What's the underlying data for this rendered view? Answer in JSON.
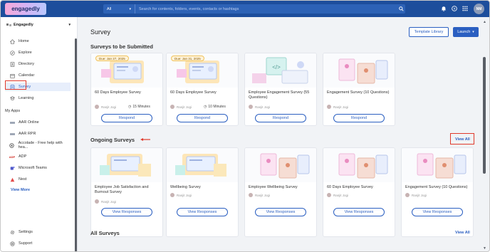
{
  "topbar": {
    "logo": "engagedly",
    "search_scope": "All",
    "search_placeholder": "Search for contents, folders, events, contacts or hashtags",
    "user_initials": "NM"
  },
  "sidebar": {
    "org_name": "Engagedly",
    "items": [
      {
        "label": "Home",
        "icon": "home-icon"
      },
      {
        "label": "Explore",
        "icon": "compass-icon"
      },
      {
        "label": "Directory",
        "icon": "directory-icon"
      },
      {
        "label": "Calendar",
        "icon": "calendar-icon"
      },
      {
        "label": "Survey",
        "icon": "survey-icon",
        "active": true
      },
      {
        "label": "Learning",
        "icon": "learning-icon"
      }
    ],
    "apps_heading": "My Apps",
    "apps": [
      {
        "label": "AAR Online",
        "icon": "app-icon"
      },
      {
        "label": "AAR RPR",
        "icon": "app-icon"
      },
      {
        "label": "Accolade - Free help with hea...",
        "icon": "accolade-icon"
      },
      {
        "label": "ADP",
        "icon": "adp-icon"
      },
      {
        "label": "Microsoft Teams",
        "icon": "teams-icon"
      },
      {
        "label": "Nest",
        "icon": "nest-icon"
      }
    ],
    "view_more": "View More",
    "footer": [
      {
        "label": "Settings",
        "icon": "gear-icon"
      },
      {
        "label": "Support",
        "icon": "support-icon"
      }
    ]
  },
  "main": {
    "title": "Survey",
    "template_library": "Template Library",
    "launch": "Launch",
    "to_submit_title": "Surveys to be Submitted",
    "to_submit": [
      {
        "title": "60 Days Employee Survey",
        "due": "Due: Jan 27, 2025",
        "owner": "Ranjit Jogi",
        "minutes": "15 Minutes",
        "action": "Respond"
      },
      {
        "title": "60 Days Employee Survey",
        "due": "Due: Jan 31, 2025",
        "owner": "Ranjit Jogi",
        "minutes": "10 Minutes",
        "action": "Respond"
      },
      {
        "title": "Employee Engagement Survey (55 Questions)",
        "due": "",
        "owner": "Ranjit Jogi",
        "minutes": "",
        "action": "Respond"
      },
      {
        "title": "Engagement Survey (10 Questions)",
        "due": "",
        "owner": "Ranjit Jogi",
        "minutes": "",
        "action": "Respond"
      }
    ],
    "ongoing_title": "Ongoing Surveys",
    "ongoing_view_all": "View All",
    "ongoing": [
      {
        "title": "Employee Job Satisfaction and Burnout Survey",
        "owner": "Ranjit Jogi",
        "action": "View Responses"
      },
      {
        "title": "Wellbeing Survey",
        "owner": "Ranjit Jogi",
        "action": "View Responses"
      },
      {
        "title": "Employee Wellbeing Survey",
        "owner": "Ranjit Jogi",
        "action": "View Responses"
      },
      {
        "title": "60 Days Employee Survey",
        "owner": "Ranjit Jogi",
        "action": "View Responses"
      },
      {
        "title": "Engagement Survey (10 Questions)",
        "owner": "Ranjit Jogi",
        "action": "View Responses"
      }
    ],
    "all_title": "All Surveys",
    "all_view_all": "View All"
  },
  "colors": {
    "topbar": "#1d4e9c",
    "accent": "#2b5fc1",
    "highlight": "#e0392b"
  }
}
